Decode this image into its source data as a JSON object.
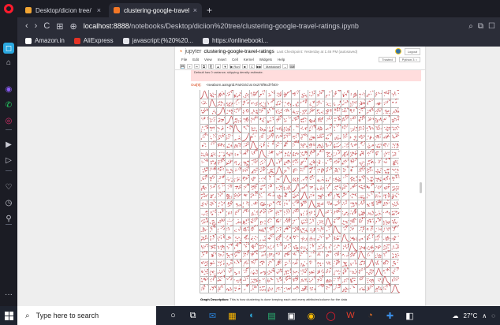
{
  "browser": {
    "tabs": [
      {
        "label": "Desktop/dicion tree/",
        "close": "×",
        "favicon_color": "#f2a533"
      },
      {
        "label": "clustering-google-travel-ra",
        "close": "×",
        "favicon_color": "#f37726"
      }
    ],
    "new_tab": "+",
    "address": {
      "host": "localhost:8888",
      "path": "/notebooks/Desktop/diciion%20tree/clustering-google-travel-ratings.ipynb"
    },
    "nav": {
      "back": "‹",
      "forward": "›",
      "reload": "C",
      "grid": "⊞",
      "globe": "⊕"
    },
    "nav_right": [
      "⌕",
      "⧉",
      "☐"
    ],
    "bookmarks": [
      {
        "label": "Amazon.in",
        "icon": "amazon-icon",
        "color": "#ffffff"
      },
      {
        "label": "AliExpress",
        "icon": "aliexpress-icon",
        "color": "#e43225"
      },
      {
        "label": "javascript:(%20%20...",
        "icon": "document-icon",
        "color": "#e3e4ea"
      },
      {
        "label": "https://onlinebooki...",
        "icon": "document-icon",
        "color": "#e3e4ea"
      }
    ]
  },
  "sidebar": {
    "items": [
      {
        "icon": "workspace-icon",
        "glyph": "◻",
        "color": "#2aa8e0"
      },
      {
        "icon": "home-icon",
        "glyph": "⌂",
        "color": "#c9cad3"
      },
      {
        "icon": "messenger-icon",
        "glyph": "◉",
        "color": "#8a5cf6"
      },
      {
        "icon": "whatsapp-icon",
        "glyph": "✆",
        "color": "#25d366"
      },
      {
        "icon": "instagram-icon",
        "glyph": "◎",
        "color": "#e1306c"
      },
      {
        "icon": "player-icon",
        "glyph": "▶",
        "color": "#c9cad3"
      },
      {
        "icon": "send-icon",
        "glyph": "▷",
        "color": "#c9cad3"
      },
      {
        "icon": "heart-icon",
        "glyph": "♡",
        "color": "#c9cad3"
      },
      {
        "icon": "history-icon",
        "glyph": "◷",
        "color": "#c9cad3"
      },
      {
        "icon": "pin-icon",
        "glyph": "⚲",
        "color": "#c9cad3"
      },
      {
        "icon": "more-icon",
        "glyph": "···",
        "color": "#c9cad3"
      }
    ]
  },
  "notebook": {
    "logo": "◔",
    "brand": "jupyter",
    "title": "clustering-google-travel-ratings",
    "checkpoint": "Last Checkpoint: Yesterday at 1:46 PM (autosaved)",
    "logout": "Logout",
    "menu": [
      "File",
      "Edit",
      "View",
      "Insert",
      "Cell",
      "Kernel",
      "Widgets",
      "Help"
    ],
    "trusted": "Trusted",
    "kernel": "Python 3 ○",
    "toolbar": [
      "💾",
      "+",
      "✂",
      "⧉",
      "⎘",
      "▲",
      "▼"
    ],
    "run_label": "▶ Run",
    "toolbar_extra": [
      "■",
      "C",
      "▶▶"
    ],
    "cell_type": "Markdown",
    "cell_type_arrow": "⌄",
    "keyboard": "⌨",
    "warning": "Default has 0 variance; skipping density estimate.",
    "cell_prompt": "Out[9]:",
    "cell_output": "<seaborn.axisgrid.PairGrid at 0x270f9cd7f40>",
    "graph_description_label": "Graph Description:",
    "graph_description_text": "This is how clustering is done keeping each and every attributes/column for the data"
  },
  "chart_data": {
    "type": "scatter",
    "kind": "pair-grid",
    "rows": 24,
    "cols": 24,
    "marker_color": "#c44e52",
    "diagonal": "density"
  },
  "taskbar": {
    "search_placeholder": "Type here to search",
    "apps": [
      {
        "icon": "search-circle-icon",
        "glyph": "○",
        "color": "#ffffff"
      },
      {
        "icon": "task-view-icon",
        "glyph": "⧉",
        "color": "#ffffff"
      },
      {
        "icon": "mail-icon",
        "glyph": "✉",
        "color": "#2a7fd4"
      },
      {
        "icon": "files-icon",
        "glyph": "▦",
        "color": "#ffb900"
      },
      {
        "icon": "edge-icon",
        "glyph": "◐",
        "color": "#2fa8d8"
      },
      {
        "icon": "sheets-icon",
        "glyph": "▤",
        "color": "#2bb673"
      },
      {
        "icon": "store-icon",
        "glyph": "▣",
        "color": "#ffffff"
      },
      {
        "icon": "chrome-icon",
        "glyph": "◉",
        "color": "#fbbc04"
      },
      {
        "icon": "opera-icon",
        "glyph": "◯",
        "color": "#ff1b2d"
      },
      {
        "icon": "office-icon",
        "glyph": "W",
        "color": "#e83e2b"
      },
      {
        "icon": "jupyter-icon",
        "glyph": "◔",
        "color": "#f37726"
      },
      {
        "icon": "medical-icon",
        "glyph": "✚",
        "color": "#3a8ee6"
      },
      {
        "icon": "notes-icon",
        "glyph": "◧",
        "color": "#ffffff"
      }
    ],
    "weather": "27°C",
    "tray_chevron": "∧"
  }
}
